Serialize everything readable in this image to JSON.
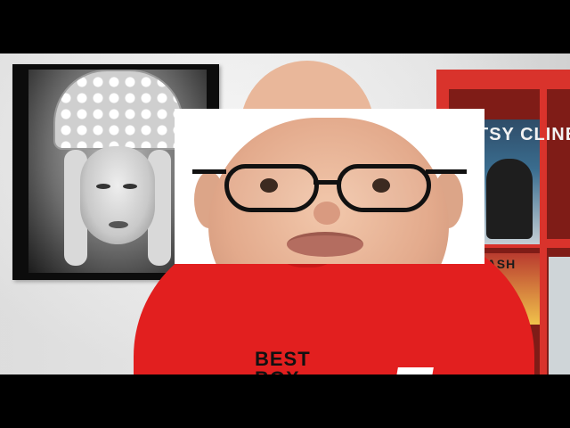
{
  "scene": {
    "type": "video-frame",
    "letterbox": true
  },
  "shelf": {
    "record_title": "TSY CLINE",
    "record2_title": "KLASH"
  },
  "shirt": {
    "text": "BEST\nBOX"
  },
  "colors": {
    "wall": "#ececec",
    "shirt": "#e21f1f",
    "shelf": "#d9332c",
    "letterbox": "#000000"
  }
}
